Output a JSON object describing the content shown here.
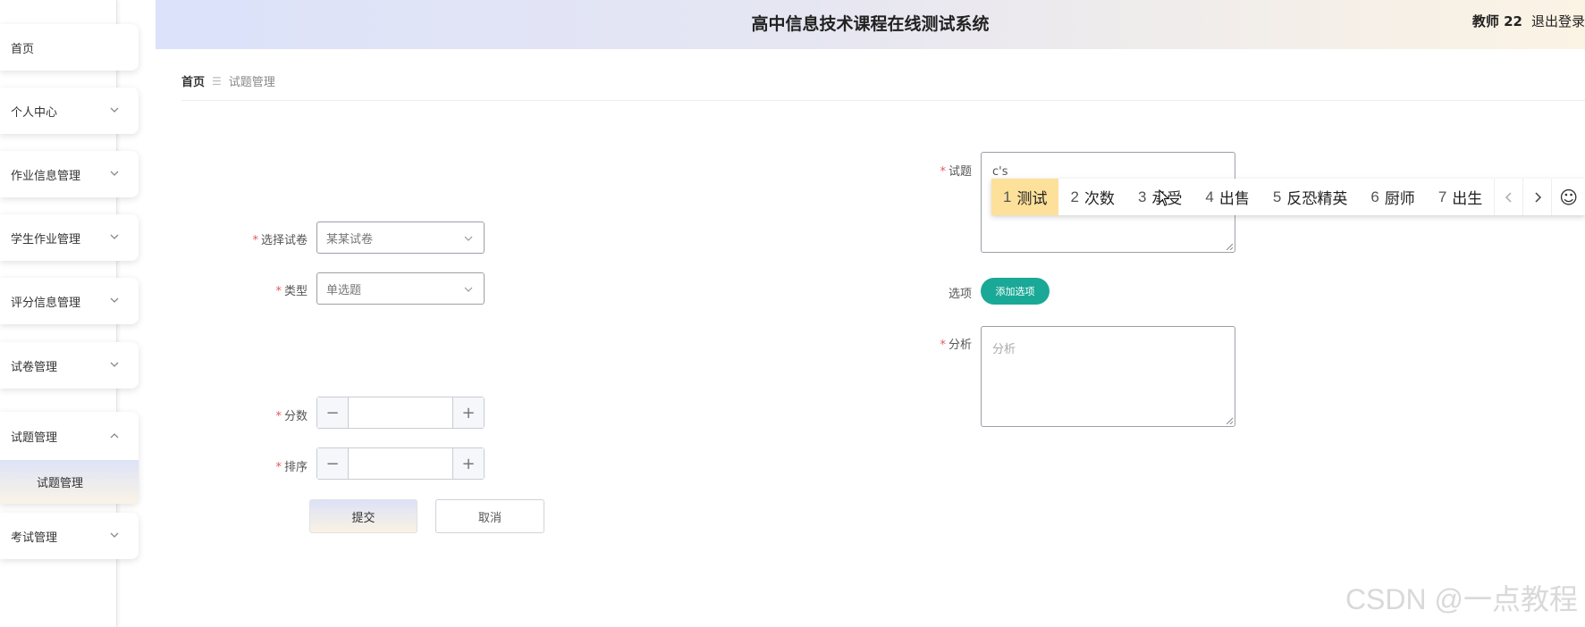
{
  "header": {
    "title": "高中信息技术课程在线测试系统",
    "user": "教师 22",
    "logout": "退出登录"
  },
  "sidebar": {
    "home": "首页",
    "items": [
      "个人中心",
      "作业信息管理",
      "学生作业管理",
      "评分信息管理",
      "试卷管理"
    ],
    "open_group": "试题管理",
    "open_sub": "试题管理",
    "last": "考试管理"
  },
  "breadcrumb": {
    "home": "首页",
    "sep": "☰",
    "current": "试题管理"
  },
  "form": {
    "paper": {
      "label": "选择试卷",
      "value": "某某试卷"
    },
    "type": {
      "label": "类型",
      "value": "单选题"
    },
    "score": {
      "label": "分数"
    },
    "order": {
      "label": "排序"
    },
    "question": {
      "label": "试题",
      "value": "c's"
    },
    "options": {
      "label": "选项",
      "add": "添加选项"
    },
    "analysis": {
      "label": "分析",
      "placeholder": "分析"
    },
    "submit": "提交",
    "cancel": "取消"
  },
  "ime": {
    "candidates": [
      {
        "n": "1",
        "t": "测试"
      },
      {
        "n": "2",
        "t": "次数"
      },
      {
        "n": "3",
        "t": "承受"
      },
      {
        "n": "4",
        "t": "出售"
      },
      {
        "n": "5",
        "t": "反恐精英"
      },
      {
        "n": "6",
        "t": "厨师"
      },
      {
        "n": "7",
        "t": "出生"
      }
    ]
  },
  "watermark": "CSDN @一点教程",
  "colors": {
    "accent": "#1aa996",
    "required": "#e45a5a",
    "ime_selected": "#fde09a"
  }
}
